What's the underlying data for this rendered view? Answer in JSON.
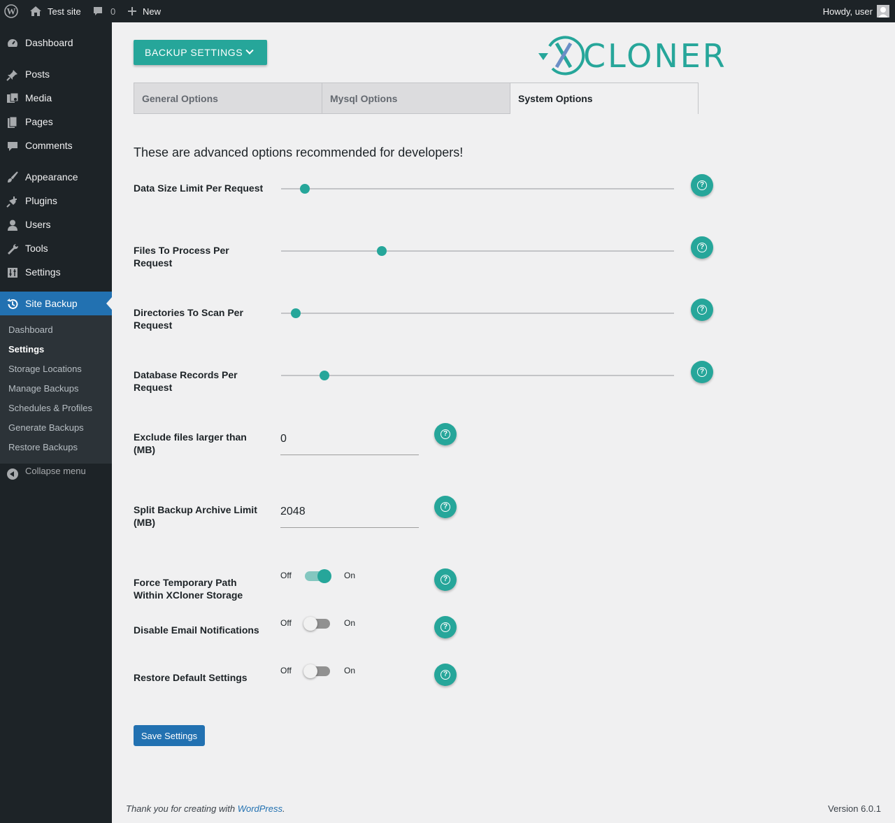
{
  "adminbar": {
    "site_name": "Test site",
    "comments_count": "0",
    "new_label": "New",
    "howdy": "Howdy, user"
  },
  "sidebar": {
    "items": [
      {
        "label": "Dashboard",
        "icon": "dashboard-icon"
      },
      {
        "label": "Posts",
        "icon": "pin-icon"
      },
      {
        "label": "Media",
        "icon": "media-icon"
      },
      {
        "label": "Pages",
        "icon": "pages-icon"
      },
      {
        "label": "Comments",
        "icon": "comments-icon"
      },
      {
        "label": "Appearance",
        "icon": "brush-icon"
      },
      {
        "label": "Plugins",
        "icon": "plug-icon"
      },
      {
        "label": "Users",
        "icon": "users-icon"
      },
      {
        "label": "Tools",
        "icon": "wrench-icon"
      },
      {
        "label": "Settings",
        "icon": "settings-icon"
      },
      {
        "label": "Site Backup",
        "icon": "history-icon"
      }
    ],
    "submenu": [
      "Dashboard",
      "Settings",
      "Storage Locations",
      "Manage Backups",
      "Schedules & Profiles",
      "Generate Backups",
      "Restore Backups"
    ],
    "collapse": "Collapse menu"
  },
  "main": {
    "backup_button": "BACKUP SETTINGS",
    "logo_text": "CLONER",
    "logo_letter": "X",
    "tabs": [
      "General Options",
      "Mysql Options",
      "System Options"
    ],
    "intro": "These are advanced options recommended for developers!",
    "sliders": [
      {
        "label": "Data Size Limit Per Request",
        "value_fraction": 0.06
      },
      {
        "label": "Files To Process Per Request",
        "value_fraction": 0.256
      },
      {
        "label": "Directories To Scan Per Request",
        "value_fraction": 0.037
      },
      {
        "label": "Database Records Per Request",
        "value_fraction": 0.11
      }
    ],
    "inputs": [
      {
        "label": "Exclude files larger than (MB)",
        "value": "0"
      },
      {
        "label": "Split Backup Archive Limit (MB)",
        "value": "2048"
      }
    ],
    "switches": [
      {
        "label": "Force Temporary Path Within XCloner Storage",
        "off": "Off",
        "on": "On",
        "state": "on"
      },
      {
        "label": "Disable Email Notifications",
        "off": "Off",
        "on": "On",
        "state": "off"
      },
      {
        "label": "Restore Default Settings",
        "off": "Off",
        "on": "On",
        "state": "off"
      }
    ],
    "save_button": "Save Settings"
  },
  "footer": {
    "thanks_prefix": "Thank you for creating with ",
    "wordpress_link": "WordPress",
    "thanks_suffix": ".",
    "version": "Version 6.0.1"
  },
  "colors": {
    "accent": "#26a69a",
    "admin_dark": "#1d2327",
    "admin_blue": "#2271b1"
  }
}
